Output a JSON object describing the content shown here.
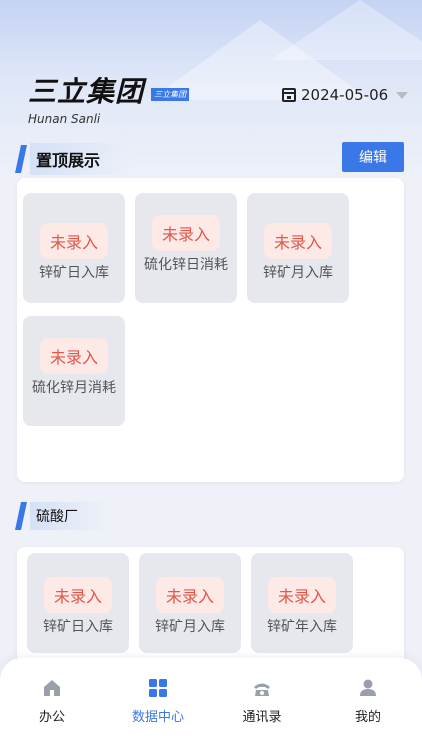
{
  "header": {
    "brand": "三立集团",
    "brand_tag": "三立集团",
    "brand_sub": "Hunan Sanli",
    "date": "2024-05-06"
  },
  "pinned": {
    "title": "置顶展示",
    "edit_label": "编辑",
    "tiles": [
      {
        "status": "未录入",
        "label": "锌矿日入库"
      },
      {
        "status": "未录入",
        "label": "硫化锌日消耗"
      },
      {
        "status": "未录入",
        "label": "锌矿月入库"
      },
      {
        "status": "未录入",
        "label": "硫化锌月消耗"
      }
    ]
  },
  "factory": {
    "title": "硫酸厂",
    "tiles": [
      {
        "status": "未录入",
        "label": "锌矿日入库"
      },
      {
        "status": "未录入",
        "label": "锌矿月入库"
      },
      {
        "status": "未录入",
        "label": "锌矿年入库"
      }
    ]
  },
  "tabbar": {
    "items": [
      {
        "label": "办公",
        "icon": "home-icon"
      },
      {
        "label": "数据中心",
        "icon": "grid-icon"
      },
      {
        "label": "通讯录",
        "icon": "phone-icon"
      },
      {
        "label": "我的",
        "icon": "user-icon"
      }
    ],
    "active_index": 1
  },
  "colors": {
    "accent": "#3a78e8",
    "badge_text": "#e0584a",
    "badge_bg": "#fde9e6"
  }
}
